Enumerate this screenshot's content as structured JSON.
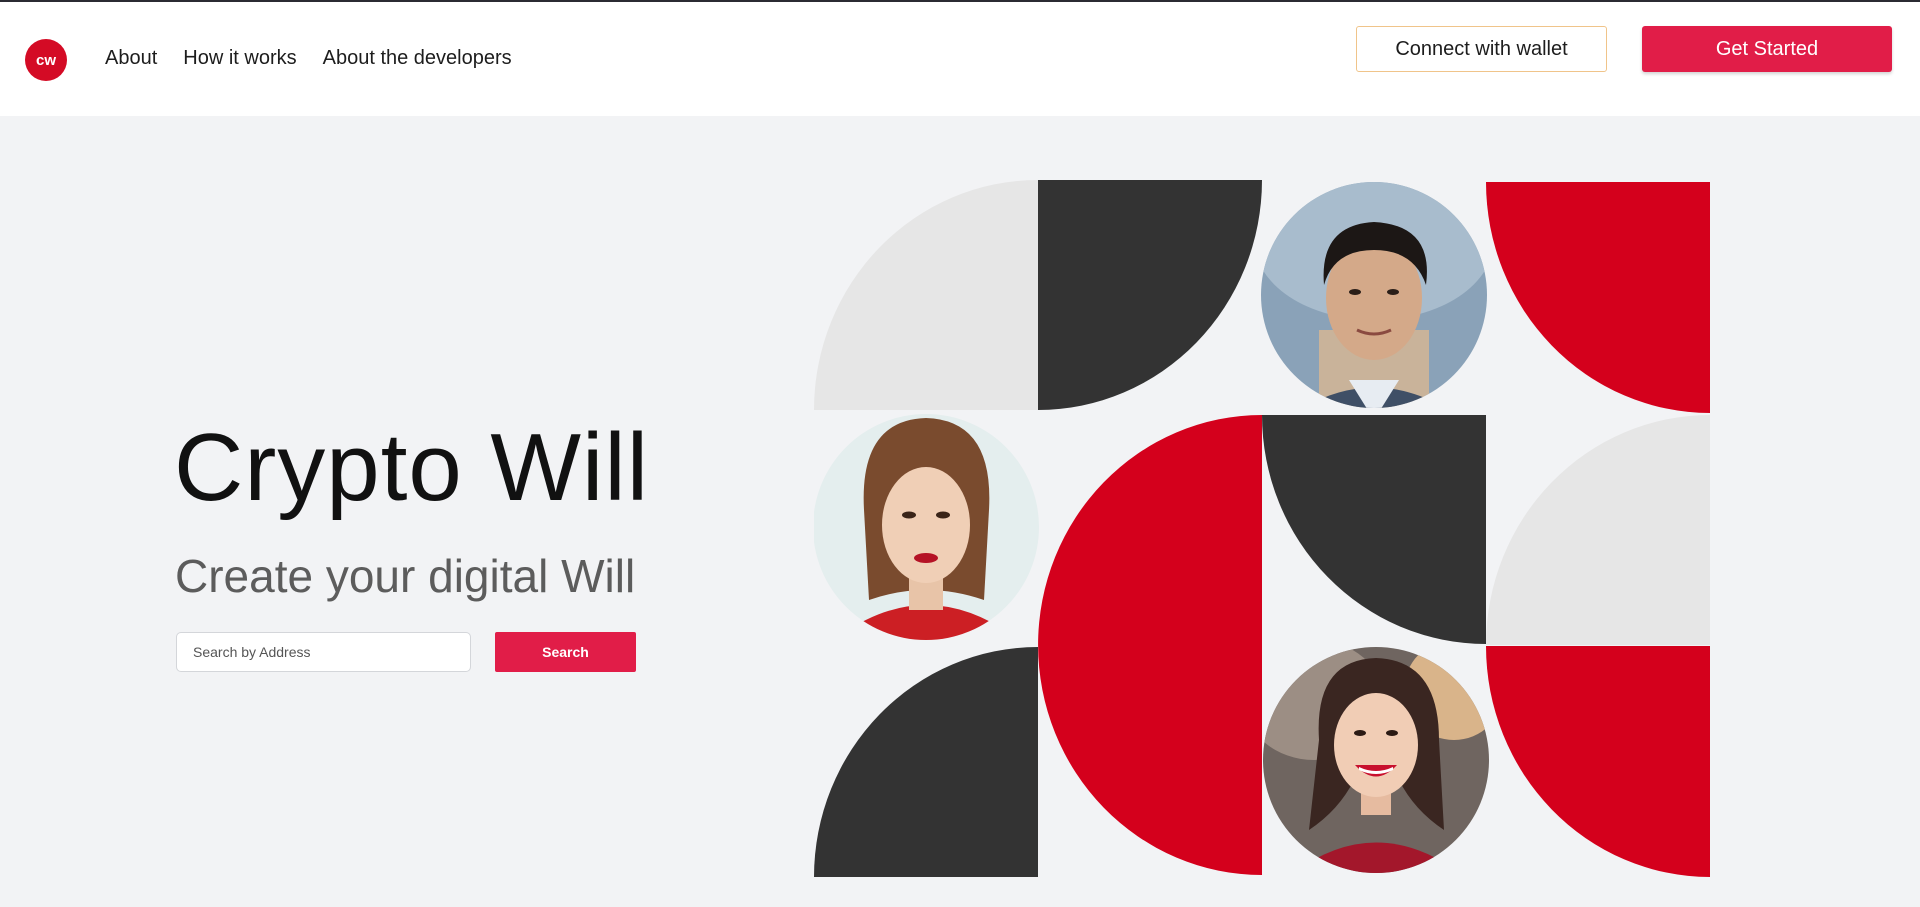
{
  "header": {
    "logo_text": "cw",
    "nav": [
      {
        "label": "About"
      },
      {
        "label": "How it works"
      },
      {
        "label": "About the developers"
      }
    ],
    "connect_wallet_label": "Connect with wallet",
    "get_started_label": "Get Started"
  },
  "hero": {
    "title": "Crypto Will",
    "subtitle": "Create your digital Will",
    "search_placeholder": "Search by Address",
    "search_button_label": "Search"
  },
  "colors": {
    "brand_red": "#e11d48",
    "mosaic_red": "#d4001c",
    "mosaic_dark": "#333333",
    "mosaic_light": "#e6e6e6",
    "background": "#f2f3f5"
  }
}
